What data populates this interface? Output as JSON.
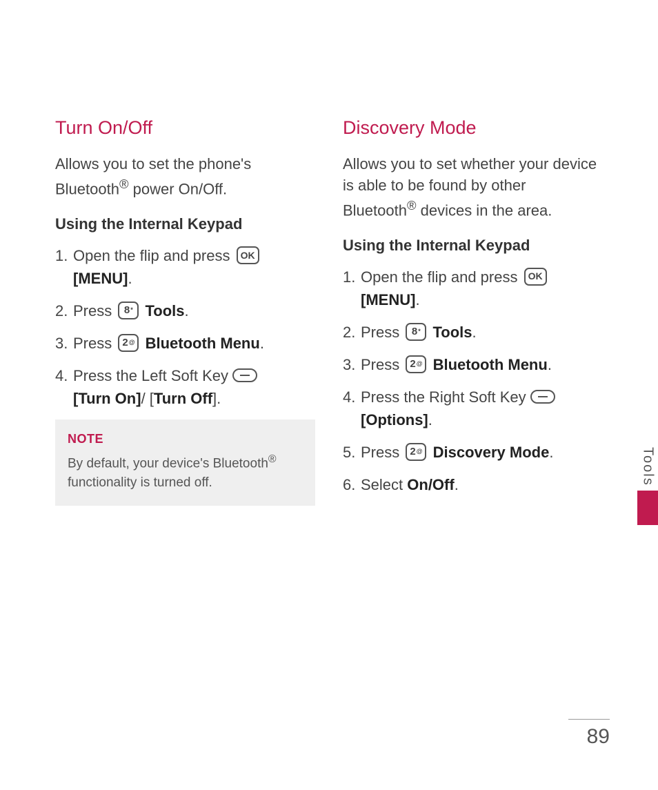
{
  "left": {
    "heading": "Turn On/Off",
    "intro_a": "Allows you to set the phone's Bluetooth",
    "intro_b": " power On/Off.",
    "subhead": "Using the Internal Keypad",
    "step1_num": "1.",
    "step1_a": "Open the flip and press ",
    "step1_key": "OK",
    "step1_menu": "[MENU]",
    "step1_dot": ".",
    "step2_num": "2.",
    "step2_a": "Press ",
    "step2_key": "8",
    "step2_keysup": "*",
    "step2_b": "Tools",
    "step2_dot": ".",
    "step3_num": "3.",
    "step3_a": "Press ",
    "step3_key": "2",
    "step3_keysup": "@",
    "step3_b": "Bluetooth Menu",
    "step3_dot": ".",
    "step4_num": "4.",
    "step4_a": "Press the Left Soft Key ",
    "step4_b1": "[Turn On]",
    "step4_b2": "/ [",
    "step4_b3": "Turn Off",
    "step4_b4": "].",
    "note_label": "NOTE",
    "note_a": "By default, your device's Bluetooth",
    "note_b": " functionality is turned off."
  },
  "right": {
    "heading": "Discovery Mode",
    "intro_a": "Allows you to set whether your device is able to be found by other Bluetooth",
    "intro_b": " devices in the area.",
    "subhead": "Using the Internal Keypad",
    "step1_num": "1.",
    "step1_a": "Open the flip and press ",
    "step1_key": "OK",
    "step1_menu": "[MENU]",
    "step1_dot": ".",
    "step2_num": "2.",
    "step2_a": "Press ",
    "step2_key": "8",
    "step2_keysup": "*",
    "step2_b": "Tools",
    "step2_dot": ".",
    "step3_num": "3.",
    "step3_a": "Press ",
    "step3_key": "2",
    "step3_keysup": "@",
    "step3_b": "Bluetooth Menu",
    "step3_dot": ".",
    "step4_num": "4.",
    "step4_a": "Press the Right Soft Key ",
    "step4_b": "[Options]",
    "step4_dot": ".",
    "step5_num": "5.",
    "step5_a": "Press ",
    "step5_key": "2",
    "step5_keysup": "@",
    "step5_b": "Discovery Mode",
    "step5_dot": ".",
    "step6_num": "6.",
    "step6_a": "Select ",
    "step6_b": "On/Off",
    "step6_dot": "."
  },
  "side_tab": "Tools",
  "page_number": "89",
  "reg_mark": "®"
}
